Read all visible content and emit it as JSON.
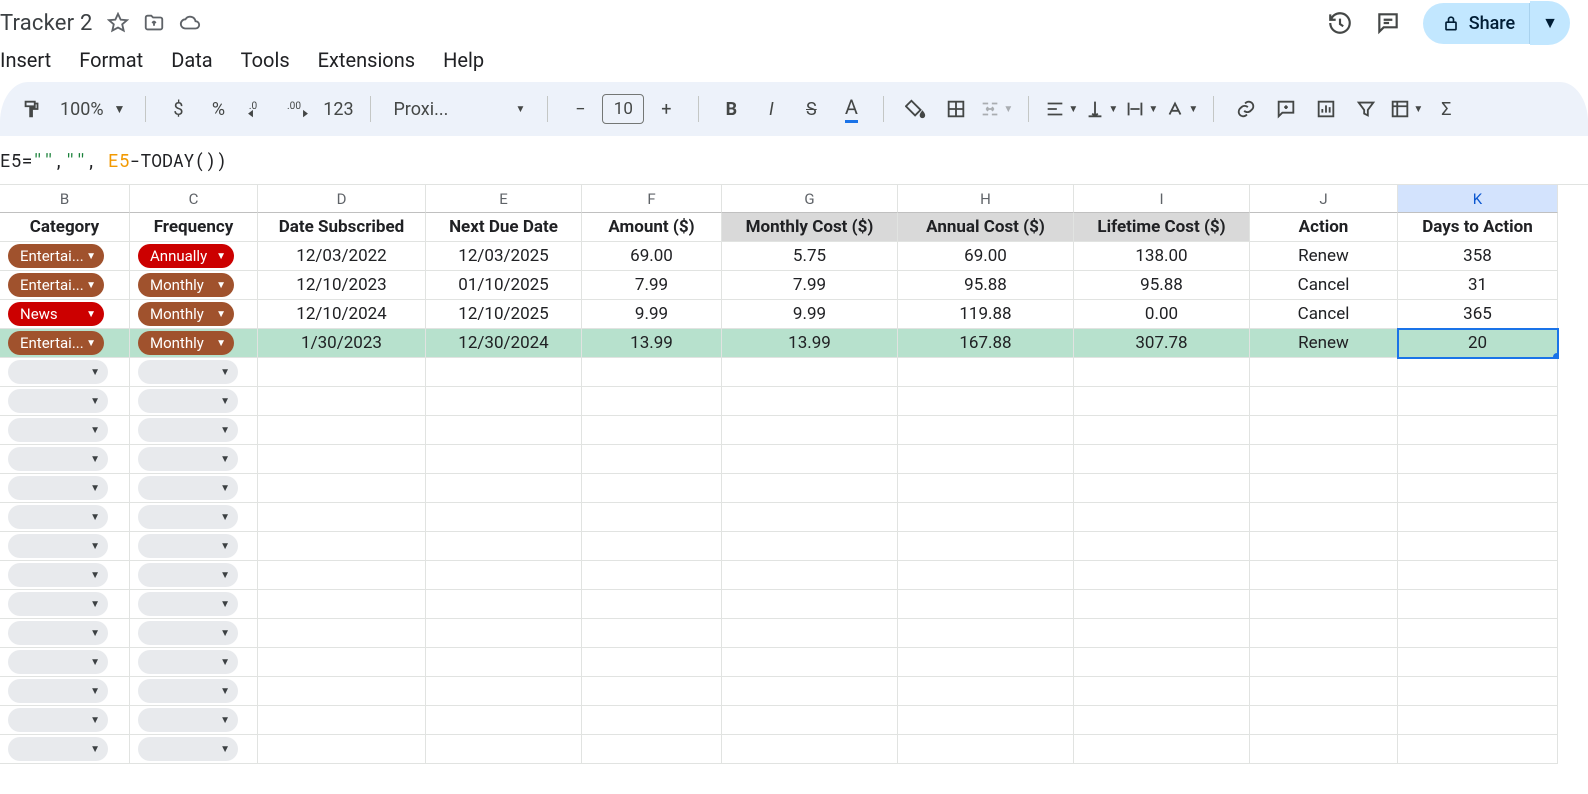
{
  "doc_title": "Tracker 2",
  "menus": [
    "Insert",
    "Format",
    "Data",
    "Tools",
    "Extensions",
    "Help"
  ],
  "share_label": "Share",
  "toolbar": {
    "zoom": "100%",
    "font_name": "Proxi...",
    "font_size": "10"
  },
  "formula_parts": {
    "p1": "E5=",
    "p2": "\"\"",
    "p3": ",",
    "p4": "\"\"",
    "p5": ", ",
    "p6": "E5",
    "p7": "-TODAY())"
  },
  "col_letters": [
    "B",
    "C",
    "D",
    "E",
    "F",
    "G",
    "H",
    "I",
    "J",
    "K"
  ],
  "selected_col": "K",
  "headers": [
    "Category",
    "Frequency",
    "Date Subscribed",
    "Next Due Date",
    "Amount ($)",
    "Monthly Cost ($)",
    "Annual Cost ($)",
    "Lifetime Cost ($)",
    "Action",
    "Days to Action"
  ],
  "shaded_header_cols": [
    "G",
    "H",
    "I"
  ],
  "rows": [
    {
      "category": "Entertai...",
      "cat_color": "brown",
      "frequency": "Annually",
      "freq_color": "red",
      "date_sub": "12/03/2022",
      "next_due": "12/03/2025",
      "amount": "69.00",
      "monthly": "5.75",
      "annual": "69.00",
      "lifetime": "138.00",
      "action": "Renew",
      "days": "358",
      "hl": false
    },
    {
      "category": "Entertai...",
      "cat_color": "brown",
      "frequency": "Monthly",
      "freq_color": "brown",
      "date_sub": "12/10/2023",
      "next_due": "01/10/2025",
      "amount": "7.99",
      "monthly": "7.99",
      "annual": "95.88",
      "lifetime": "95.88",
      "action": "Cancel",
      "days": "31",
      "hl": false
    },
    {
      "category": "News",
      "cat_color": "red",
      "frequency": "Monthly",
      "freq_color": "brown",
      "date_sub": "12/10/2024",
      "next_due": "12/10/2025",
      "amount": "9.99",
      "monthly": "9.99",
      "annual": "119.88",
      "lifetime": "0.00",
      "action": "Cancel",
      "days": "365",
      "hl": false
    },
    {
      "category": "Entertai...",
      "cat_color": "brown",
      "frequency": "Monthly",
      "freq_color": "brown",
      "date_sub": "1/30/2023",
      "next_due": "12/30/2024",
      "amount": "13.99",
      "monthly": "13.99",
      "annual": "167.88",
      "lifetime": "307.78",
      "action": "Renew",
      "days": "20",
      "hl": true
    }
  ],
  "empty_row_count": 14,
  "active_cell": "K5"
}
